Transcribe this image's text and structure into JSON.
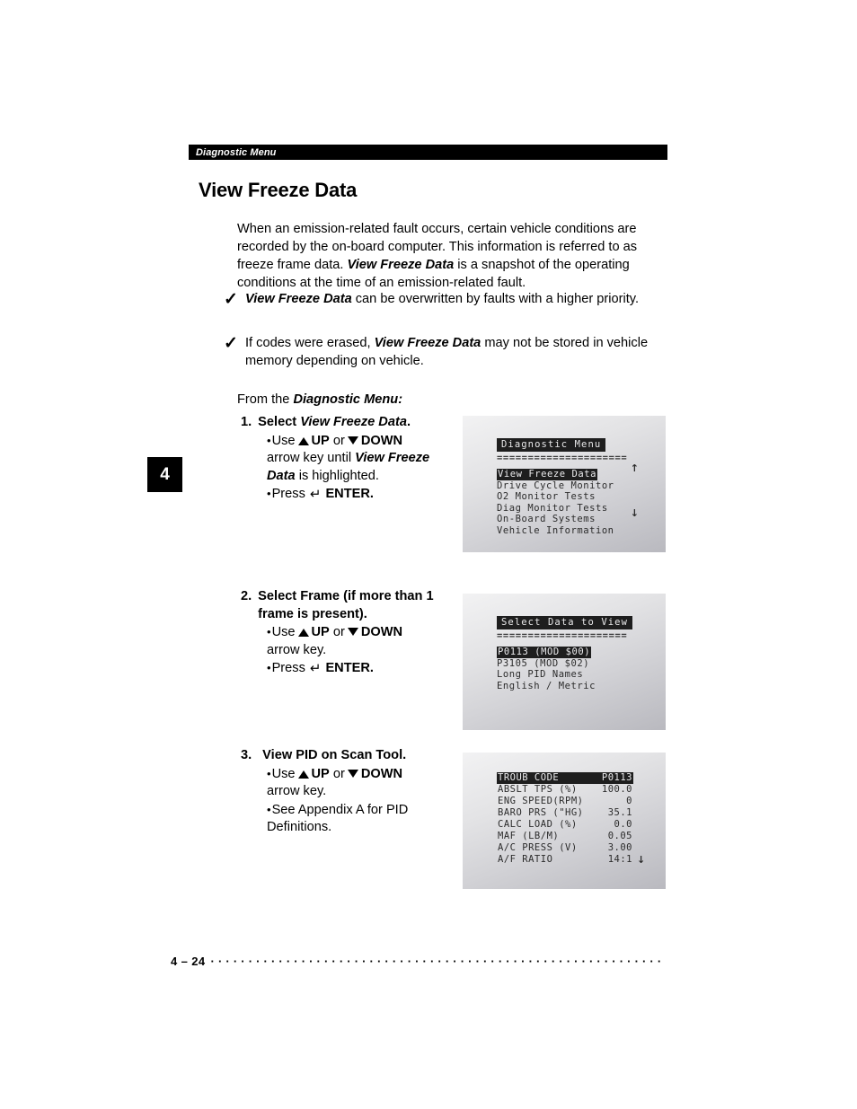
{
  "running_head": {
    "label": "Diagnostic Menu"
  },
  "page_title": "View Freeze Data",
  "intro": {
    "part1": "When an emission-related fault occurs, certain vehicle conditions are recorded by the on-board computer. This information is referred to as freeze frame data. ",
    "emphasis": "View Freeze Data",
    "part2": " is a snapshot of the operating conditions at the time of an emission-related fault."
  },
  "check_notes": [
    {
      "glyph": "✓",
      "emphasis": "View Freeze Data",
      "text": " can be overwritten by faults with a higher priority."
    },
    {
      "glyph": "✓",
      "pre": "If codes were erased, ",
      "emphasis": "View Freeze Data",
      "text": " may not be stored in vehicle memory depending on vehicle."
    }
  ],
  "chapter_tab": {
    "number": "4"
  },
  "from_the": {
    "pre": "From the ",
    "emphasis": "Diagnostic Menu:"
  },
  "steps": [
    {
      "number": "1.",
      "title_pre": "Select ",
      "title_em": "View Freeze Data",
      "title_post": ".",
      "bullet1_pre": "Use",
      "bullet1_up": "UP",
      "bullet1_or": "or",
      "bullet1_down": "DOWN",
      "bullet1_cont_pre": "arrow key until ",
      "bullet1_cont_em": "View Freeze Data",
      "bullet1_cont_post": " is highlighted.",
      "bullet2_pre": "Press",
      "bullet2_key": "ENTER."
    },
    {
      "number": "2.",
      "title": "Select Frame (if more than 1 frame is present).",
      "bullet1_pre": "Use",
      "bullet1_up": "UP",
      "bullet1_or": "or",
      "bullet1_down": "DOWN",
      "bullet1_cont": "arrow key.",
      "bullet2_pre": "Press",
      "bullet2_key": "ENTER."
    },
    {
      "number": "3.",
      "title": "View PID on Scan Tool.",
      "bullet1_pre": "Use",
      "bullet1_up": "UP",
      "bullet1_or": "or",
      "bullet1_down": "DOWN",
      "bullet1_cont": "arrow key.",
      "bullet2": "See Appendix A for PID Definitions."
    }
  ],
  "lcd_screens": [
    {
      "title": "Diagnostic Menu",
      "rule": "=====================",
      "items": [
        {
          "label": "View Freeze Data",
          "highlighted": true,
          "arrow": "↑"
        },
        {
          "label": "Drive Cycle Monitor",
          "highlighted": false,
          "arrow": ""
        },
        {
          "label": "O2 Monitor Tests",
          "highlighted": false,
          "arrow": ""
        },
        {
          "label": "Diag Monitor Tests",
          "highlighted": false,
          "arrow": ""
        },
        {
          "label": "On-Board Systems",
          "highlighted": false,
          "arrow": "↓"
        },
        {
          "label": "Vehicle Information",
          "highlighted": false,
          "arrow": ""
        }
      ]
    },
    {
      "title": "Select Data to View",
      "rule": "=====================",
      "items": [
        {
          "label": "P0113 (MOD $00)",
          "highlighted": true,
          "arrow": ""
        },
        {
          "label": "P3105 (MOD $02)",
          "highlighted": false,
          "arrow": ""
        },
        {
          "label": "Long PID Names",
          "highlighted": false,
          "arrow": ""
        },
        {
          "label": "English / Metric",
          "highlighted": false,
          "arrow": ""
        }
      ]
    }
  ],
  "lcd_pid_screen": {
    "rows": [
      {
        "label": "TROUB CODE",
        "value": "P0113",
        "highlighted": true,
        "arrow": ""
      },
      {
        "label": "ABSLT TPS (%)",
        "value": "100.0",
        "highlighted": false,
        "arrow": ""
      },
      {
        "label": "ENG SPEED(RPM)",
        "value": "0",
        "highlighted": false,
        "arrow": ""
      },
      {
        "label": "BARO PRS (\"HG)",
        "value": "35.1",
        "highlighted": false,
        "arrow": ""
      },
      {
        "label": "CALC LOAD (%)",
        "value": "0.0",
        "highlighted": false,
        "arrow": ""
      },
      {
        "label": "MAF (LB/M)",
        "value": "0.05",
        "highlighted": false,
        "arrow": ""
      },
      {
        "label": "A/C PRESS (V)",
        "value": "3.00",
        "highlighted": false,
        "arrow": ""
      },
      {
        "label": "A/F RATIO",
        "value": "14:1",
        "highlighted": false,
        "arrow": "↓"
      }
    ]
  },
  "footer": {
    "folio": "4 – 24",
    "dots": "····························································"
  }
}
